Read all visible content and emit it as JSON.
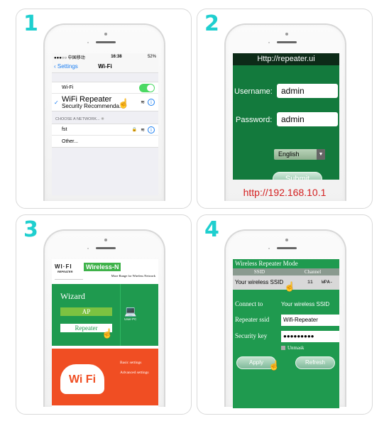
{
  "steps": [
    {
      "number": "1",
      "screen": "ios-wifi-settings",
      "status_bar": {
        "carrier": "●●●○○ 中国移动",
        "time": "16:38",
        "battery": "52%"
      },
      "nav": {
        "back_label": "Settings",
        "title": "Wi-Fi"
      },
      "wifi_toggle": {
        "label": "Wi-Fi",
        "on": true
      },
      "connected_network": {
        "name": "WiFi Repeater",
        "subtitle": "Security Recommenda..."
      },
      "section_header": "CHOOSE A NETWORK...",
      "networks": [
        {
          "name": "fst",
          "locked": true
        },
        {
          "name": "Other...",
          "locked": false
        }
      ],
      "accent_color": "#1a7ef2"
    },
    {
      "number": "2",
      "screen": "router-login",
      "header_title": "Http://repeater.ui",
      "username_label": "Username:",
      "username_value": "admin",
      "password_label": "Password:",
      "password_value": "admin",
      "language_selected": "English",
      "submit_label": "Submit",
      "caption_url": "http://192.168.10.1",
      "accent_color": "#137a3d"
    },
    {
      "number": "3",
      "screen": "admin-wizard",
      "logo_text": "WI·FI",
      "logo_sub": "REPEATER",
      "badge": "Wireless-N",
      "tagline": "More Range for Wireless Network",
      "wizard_title": "Wizard",
      "ap_label": "AP",
      "repeater_label": "Repeater",
      "pc_label": "User-PC",
      "wifi_logo_text": "Wi Fi",
      "menu_items": [
        "Basic settings",
        "Advanced settings"
      ]
    },
    {
      "number": "4",
      "screen": "wireless-repeater-mode",
      "header_title": "Wireless Repeater Mode",
      "table_headers": [
        "SSID",
        "Channel"
      ],
      "table_row": {
        "ssid": "Your wireless SSID",
        "channel": "11",
        "security": "WPA-"
      },
      "connect_to_label": "Connect to",
      "connect_to_value": "Your wireless SSID",
      "repeater_ssid_label": "Repeater ssid",
      "repeater_ssid_value": "Wifi-Repeater",
      "security_key_label": "Security key",
      "security_key_value": "●●●●●●●●●",
      "unmask_label": "Unmask",
      "apply_label": "Apply",
      "refresh_label": "Refresh"
    }
  ],
  "step_number_color": "#1fcfcf"
}
